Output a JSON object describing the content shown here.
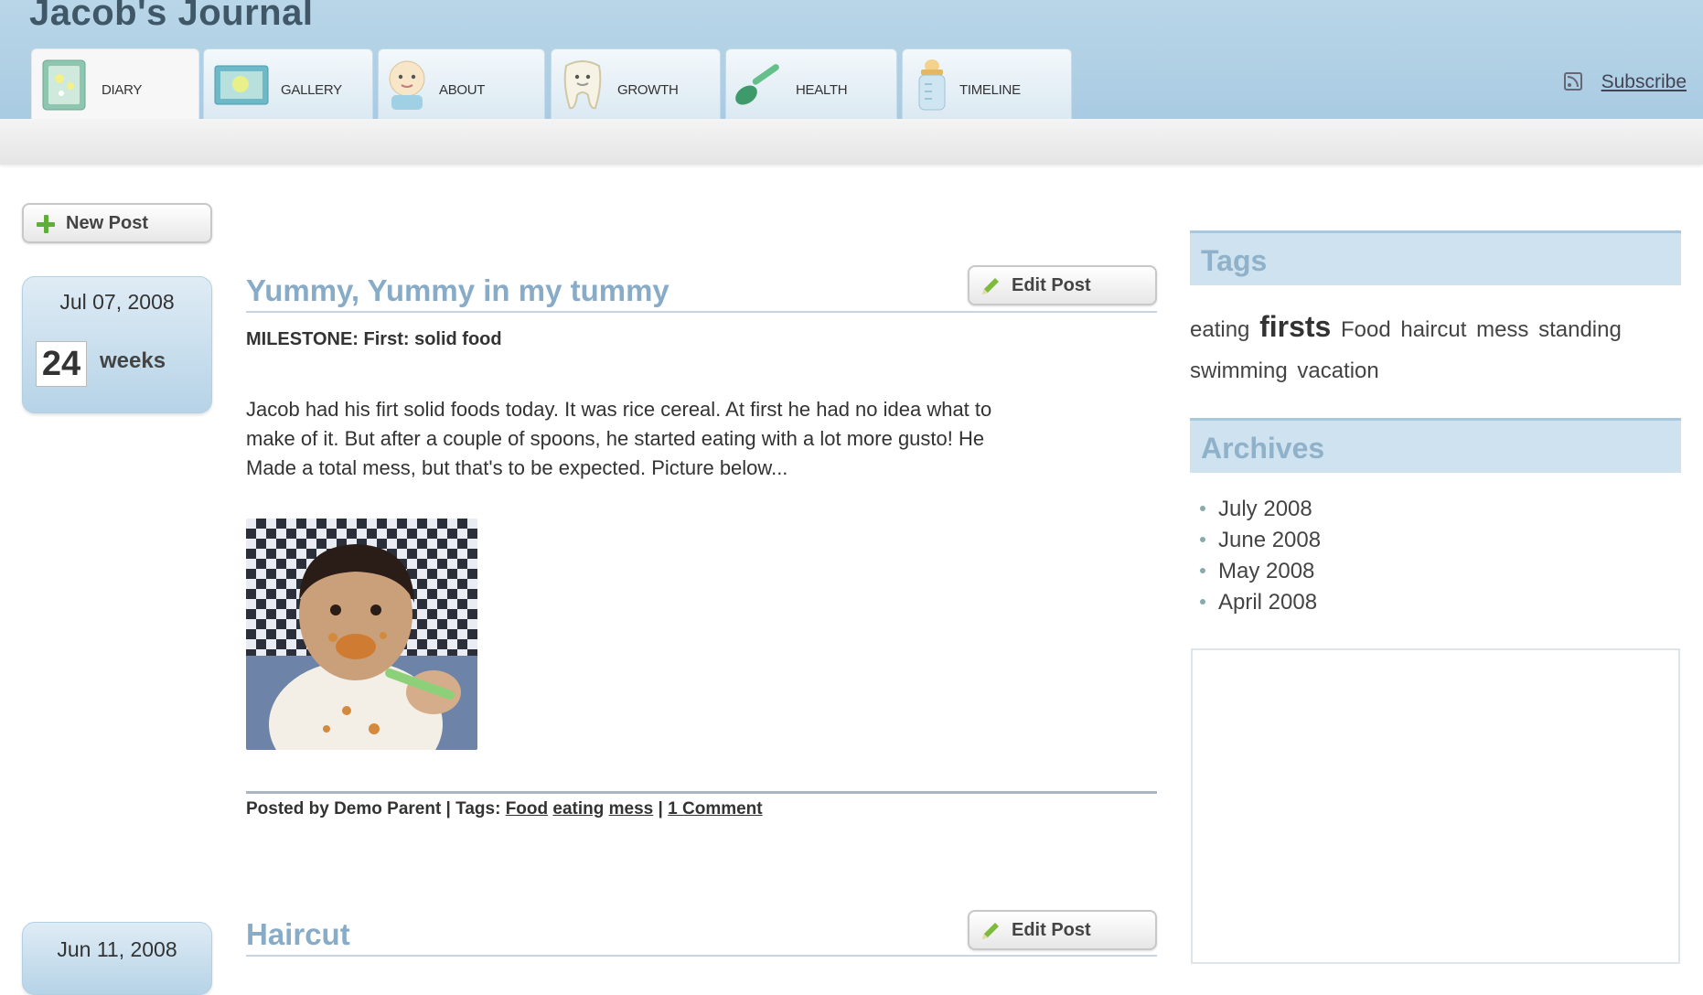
{
  "site": {
    "title": "Jacob's Journal"
  },
  "nav": {
    "tabs": [
      {
        "label": "DIARY",
        "icon": "diary-icon",
        "active": true
      },
      {
        "label": "GALLERY",
        "icon": "gallery-icon",
        "active": false
      },
      {
        "label": "ABOUT",
        "icon": "baby-face-icon",
        "active": false
      },
      {
        "label": "GROWTH",
        "icon": "tooth-icon",
        "active": false
      },
      {
        "label": "HEALTH",
        "icon": "spoon-icon",
        "active": false
      },
      {
        "label": "TIMELINE",
        "icon": "bottle-icon",
        "active": false
      }
    ],
    "subscribe_label": "Subscribe"
  },
  "actions": {
    "new_post_label": "New Post"
  },
  "posts": [
    {
      "date": "Jul 07, 2008",
      "weeks_value": "24",
      "weeks_label": "weeks",
      "title": "Yummy, Yummy in my tummy",
      "edit_label": "Edit Post",
      "milestone": "MILESTONE: First: solid food",
      "body_lines": [
        "Jacob had his firt solid foods today.  It was rice cereal. At first he had no idea what to",
        "make of it. But after a couple of spoons, he started eating with a lot more gusto! He",
        "Made a total mess, but that's to be expected. Picture below..."
      ],
      "footer": {
        "posted_by": "Posted by Demo Parent | Tags:",
        "tags": [
          "Food",
          "eating",
          "mess"
        ],
        "separator": "|",
        "comments": "1 Comment"
      }
    },
    {
      "date": "Jun 11, 2008",
      "title": "Haircut",
      "edit_label": "Edit Post"
    }
  ],
  "sidebar": {
    "tags_title": "Tags",
    "tags": [
      {
        "label": "eating",
        "emphasis": false
      },
      {
        "label": "firsts",
        "emphasis": true
      },
      {
        "label": "Food",
        "emphasis": false
      },
      {
        "label": "haircut",
        "emphasis": false
      },
      {
        "label": "mess",
        "emphasis": false
      },
      {
        "label": "standing",
        "emphasis": false
      },
      {
        "label": "swimming",
        "emphasis": false
      },
      {
        "label": "vacation",
        "emphasis": false
      }
    ],
    "archives_title": "Archives",
    "archives": [
      "July 2008",
      "June 2008",
      "May 2008",
      "April 2008"
    ]
  },
  "colors": {
    "header_blue": "#b9d6e8",
    "title_blue": "#88acc8",
    "accent_green": "#5fae3a"
  }
}
